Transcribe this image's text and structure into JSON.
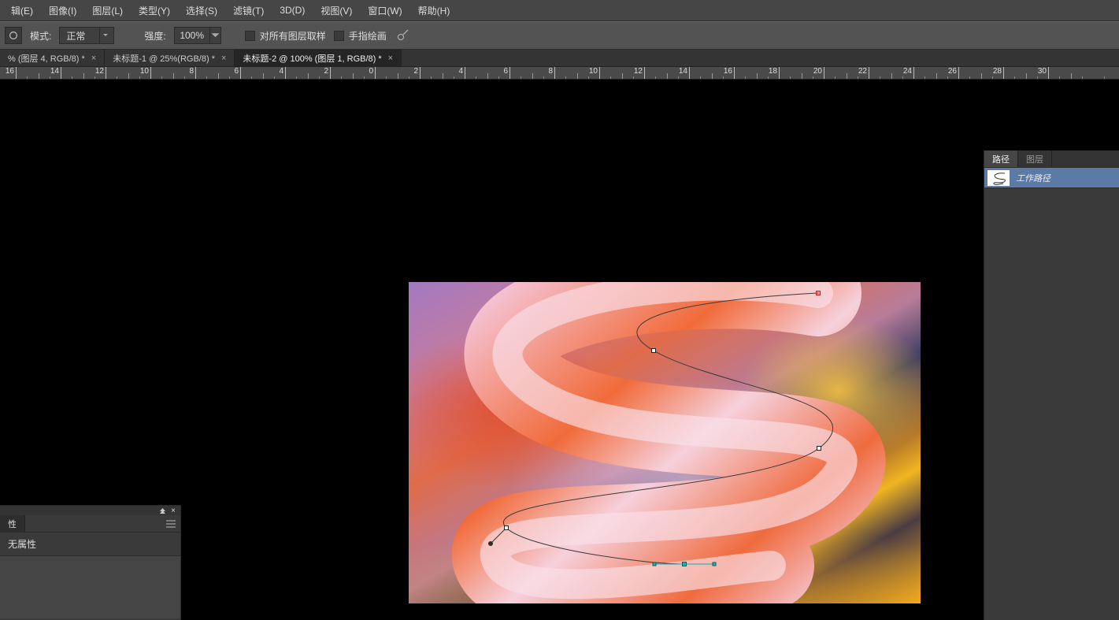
{
  "menu": {
    "items": [
      "辑(E)",
      "图像(I)",
      "图层(L)",
      "类型(Y)",
      "选择(S)",
      "滤镜(T)",
      "3D(D)",
      "视图(V)",
      "窗口(W)",
      "帮助(H)"
    ]
  },
  "options": {
    "mode_label": "模式:",
    "mode_value": "正常",
    "strength_label": "强度:",
    "strength_value": "100%",
    "sample_all_label": "对所有图层取样",
    "finger_paint_label": "手指绘画"
  },
  "tabs": [
    {
      "label": "% (图层 4, RGB/8) *",
      "active": false
    },
    {
      "label": "未标题-1 @ 25%(RGB/8) *",
      "active": false
    },
    {
      "label": "未标题-2 @ 100% (图层 1, RGB/8) *",
      "active": true
    }
  ],
  "ruler": {
    "majors": [
      16,
      14,
      12,
      10,
      8,
      6,
      4,
      2,
      0,
      2,
      4,
      6,
      8,
      10,
      12,
      14,
      16,
      18,
      20,
      22,
      24,
      26,
      28,
      30
    ]
  },
  "props_panel": {
    "tab_label": "性",
    "heading": "无属性"
  },
  "right_panel": {
    "tab_paths": "路径",
    "tab_layers": "图层",
    "work_path": "工作路径"
  }
}
